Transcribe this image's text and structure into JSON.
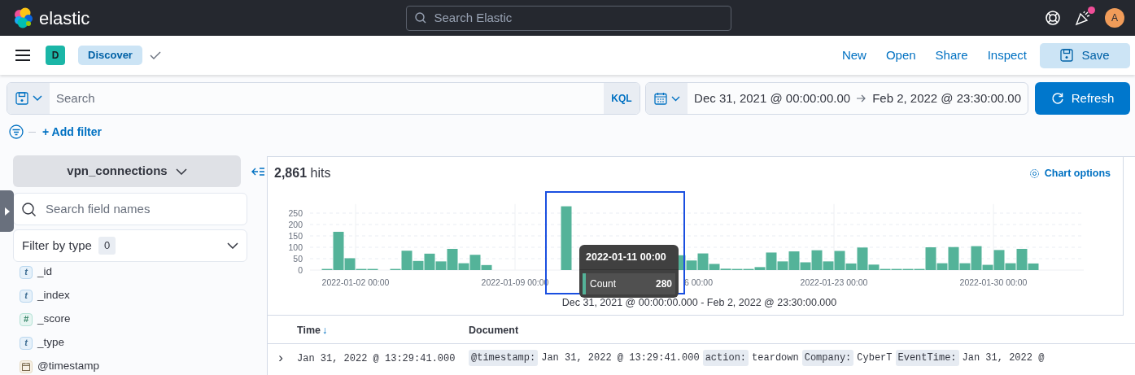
{
  "header": {
    "brand": "elastic",
    "search_placeholder": "Search Elastic",
    "news_unread": true,
    "avatar": "A"
  },
  "app_bar": {
    "space": "D",
    "breadcrumb": "Discover",
    "links": [
      "New",
      "Open",
      "Share",
      "Inspect"
    ],
    "save_button": "Save"
  },
  "query_bar": {
    "placeholder": "Search",
    "language": "KQL",
    "start": "Dec 31, 2021 @ 00:00:00.00",
    "end": "Feb 2, 2022 @ 23:30:00.00",
    "refresh_button": "Refresh"
  },
  "filter_bar": {
    "add_filter": "+ Add filter"
  },
  "sidebar": {
    "index_pattern": "vpn_connections",
    "field_search_placeholder": "Search field names",
    "filter_by_type": "Filter by type",
    "filter_count": "0",
    "fields": [
      {
        "name": "_id",
        "kind": "string",
        "glyph": "t"
      },
      {
        "name": "_index",
        "kind": "string",
        "glyph": "t"
      },
      {
        "name": "_score",
        "kind": "number",
        "glyph": "#"
      },
      {
        "name": "_type",
        "kind": "string",
        "glyph": "t"
      },
      {
        "name": "@timestamp",
        "kind": "date"
      }
    ]
  },
  "histogram": {
    "hits_count": "2,861",
    "hits_label": "hits",
    "chart_options": "Chart options",
    "time_range": "Dec 31, 2021 @ 00:00:00.000 - Feb 2, 2022 @ 23:30:00.000",
    "tooltip": {
      "title": "2022-01-11 00:00",
      "value": "280"
    },
    "covered_tick_label": "6 00:00",
    "chart_data": {
      "type": "bar",
      "categories": [
        null,
        null,
        null,
        null,
        "2022-01-02 00:00",
        null,
        null,
        null,
        null,
        null,
        null,
        null,
        null,
        null,
        null,
        null,
        null,
        null,
        "2022-01-09 00:00",
        null,
        null,
        null,
        null,
        null,
        null,
        null,
        null,
        null,
        null,
        null,
        null,
        null,
        null,
        null,
        null,
        null,
        null,
        null,
        null,
        null,
        null,
        null,
        null,
        null,
        null,
        null,
        "2022-01-23 00:00",
        null,
        null,
        null,
        null,
        null,
        null,
        null,
        null,
        null,
        null,
        null,
        null,
        null,
        "2022-01-30 00:00",
        null,
        null,
        null
      ],
      "series": [
        {
          "name": "Count",
          "color": "#54b399",
          "values": [
            0,
            5,
            168,
            52,
            5,
            5,
            0,
            5,
            85,
            40,
            72,
            38,
            93,
            30,
            67,
            22,
            0,
            0,
            0,
            0,
            0,
            0,
            280,
            null,
            null,
            null,
            null,
            null,
            null,
            null,
            null,
            null,
            65,
            42,
            73,
            27,
            6,
            5,
            5,
            13,
            77,
            38,
            82,
            34,
            87,
            38,
            84,
            29,
            99,
            24,
            5,
            5,
            5,
            5,
            100,
            30,
            101,
            30,
            105,
            23,
            88,
            30,
            93,
            29
          ]
        }
      ],
      "ylim": [
        0,
        290
      ],
      "yticks": [
        0,
        50,
        100,
        150,
        200,
        250
      ],
      "grid": true
    }
  },
  "table": {
    "columns": [
      {
        "label": "Time",
        "sort": "↓"
      },
      {
        "label": "Document"
      }
    ],
    "rows": [
      {
        "expand": "›",
        "time": "Jan 31, 2022 @ 13:29:41.000",
        "document": [
          {
            "key": "@timestamp:",
            "value": "Jan 31, 2022 @ 13:29:41.000"
          },
          {
            "key": "action:",
            "value": "teardown"
          },
          {
            "key": "Company:",
            "value": "CyberT"
          },
          {
            "key": "EventTime:",
            "value": "Jan 31, 2022 @"
          }
        ]
      }
    ]
  }
}
